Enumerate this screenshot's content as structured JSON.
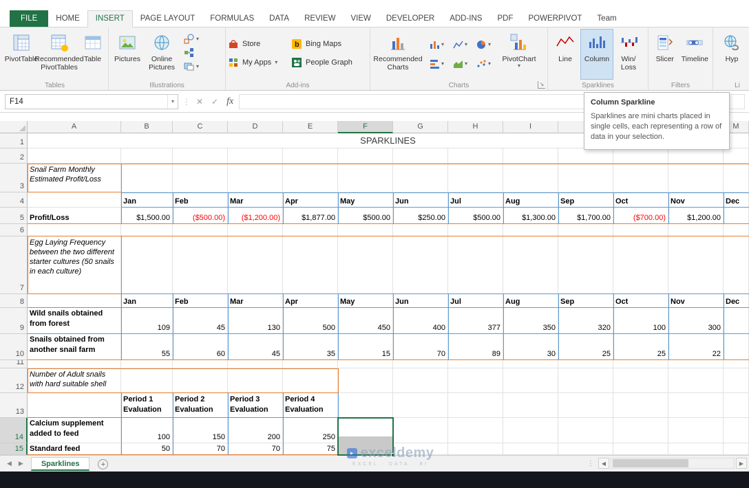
{
  "tabs": {
    "items": [
      "FILE",
      "HOME",
      "INSERT",
      "PAGE LAYOUT",
      "FORMULAS",
      "DATA",
      "REVIEW",
      "VIEW",
      "DEVELOPER",
      "ADD-INS",
      "PDF",
      "POWERPIVOT",
      "Team"
    ],
    "active": "INSERT"
  },
  "ribbon": {
    "groups": [
      {
        "label": "Tables",
        "buttons": [
          {
            "label": "PivotTable"
          },
          {
            "label": "Recommended PivotTables"
          },
          {
            "label": "Table"
          }
        ]
      },
      {
        "label": "Illustrations",
        "buttons": [
          {
            "label": "Pictures"
          },
          {
            "label": "Online Pictures"
          }
        ]
      },
      {
        "label": "Add-ins",
        "buttons": [
          {
            "label": "Store"
          },
          {
            "label": "My Apps"
          },
          {
            "label": "Bing Maps"
          },
          {
            "label": "People Graph"
          }
        ]
      },
      {
        "label": "Charts",
        "buttons": [
          {
            "label": "Recommended Charts"
          },
          {
            "label": "PivotChart"
          }
        ]
      },
      {
        "label": "Sparklines",
        "active_button": "Column",
        "buttons": [
          {
            "label": "Line"
          },
          {
            "label": "Column"
          },
          {
            "label": "Win/ Loss"
          }
        ]
      },
      {
        "label": "Filters",
        "buttons": [
          {
            "label": "Slicer"
          },
          {
            "label": "Timeline"
          }
        ]
      },
      {
        "label": "Li",
        "buttons": [
          {
            "label": "Hyp"
          }
        ]
      }
    ]
  },
  "formula_bar": {
    "name_box": "F14",
    "formula": ""
  },
  "tooltip": {
    "title": "Column Sparkline",
    "body": "Sparklines are mini charts placed in single cells, each representing a row of data in your selection."
  },
  "sheet": {
    "columns": [
      "A",
      "B",
      "C",
      "D",
      "E",
      "F",
      "G",
      "H",
      "I",
      "J",
      "K",
      "L",
      "M"
    ],
    "selected_column": "F",
    "row_count": 15,
    "selected_rows": [
      14,
      15
    ],
    "active_cell": "F14",
    "title": "SPARKLINES",
    "months": [
      "Jan",
      "Feb",
      "Mar",
      "Apr",
      "May",
      "Jun",
      "Jul",
      "Aug",
      "Sep",
      "Oct",
      "Nov",
      "Dec"
    ],
    "sections": [
      {
        "label": "Snail Farm Monthly Estimated Profit/Loss",
        "rows": [
          {
            "label": "Profit/Loss",
            "values": [
              "$1,500.00",
              "($500.00)",
              "($1,200.00)",
              "$1,877.00",
              "$500.00",
              "$250.00",
              "$500.00",
              "$1,300.00",
              "$1,700.00",
              "($700.00)",
              "$1,200.00"
            ]
          }
        ]
      },
      {
        "label": "Egg Laying Frequency between the two different starter cultures (50 snails in each culture)",
        "rows": [
          {
            "label": "Wild snails obtained from forest",
            "values": [
              "109",
              "45",
              "130",
              "500",
              "450",
              "400",
              "377",
              "350",
              "320",
              "100",
              "300"
            ]
          },
          {
            "label": "Snails obtained from another snail farm",
            "values": [
              "55",
              "60",
              "45",
              "35",
              "15",
              "70",
              "89",
              "30",
              "25",
              "25",
              "22"
            ]
          }
        ]
      },
      {
        "label": "Number of Adult snails with hard suitable shell",
        "headers": [
          "Period 1 Evaluation",
          "Period 2 Evaluation",
          "Period 3 Evaluation",
          "Period 4 Evaluation"
        ],
        "rows": [
          {
            "label": "Calcium supplement added to feed",
            "values": [
              "100",
              "150",
              "200",
              "250"
            ]
          },
          {
            "label": "Standard feed",
            "values": [
              "50",
              "70",
              "70",
              "75"
            ]
          }
        ]
      }
    ]
  },
  "sheet_tabs": {
    "active": "Sparklines"
  },
  "watermark": {
    "text": "exceldemy",
    "subtext": "EXCEL · DATA · BI"
  },
  "colors": {
    "accent_green": "#217346",
    "negative_red": "#ff0000",
    "orange_border": "#e87d31",
    "blue_border": "#5b9bd5",
    "sparkline_active_bg": "#cfe2f3"
  }
}
